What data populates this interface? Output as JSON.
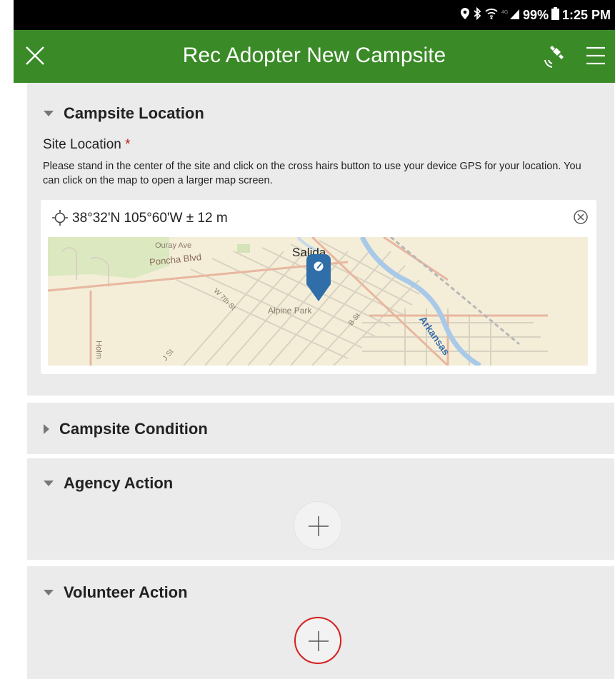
{
  "status_bar": {
    "battery": "99%",
    "time": "1:25 PM"
  },
  "app_bar": {
    "title": "Rec Adopter New Campsite"
  },
  "campsite_location": {
    "header": "Campsite Location",
    "site_label": "Site Location",
    "required_mark": "*",
    "help_text": "Please stand in the center of the site and click on the cross hairs button to use your device GPS for your location. You can click on the map to open a larger map screen.",
    "coordinates": "38°32'N 105°60'W ± 12 m",
    "map_labels": {
      "city": "Salida",
      "park": "Alpine Park",
      "street_1": "Ouray Ave",
      "street_2": "Poncha Blvd",
      "street_3": "W 7th St",
      "street_4": "B St",
      "street_5": "Holm",
      "street_6": "J St",
      "river": "Arkansas"
    }
  },
  "campsite_condition": {
    "header": "Campsite Condition"
  },
  "agency_action": {
    "header": "Agency Action"
  },
  "volunteer_action": {
    "header": "Volunteer Action"
  },
  "colors": {
    "app_bar": "#3a8a27",
    "panel": "#ebebeb",
    "required": "#c01818",
    "highlight": "#d62020",
    "pin": "#2f6ea8"
  }
}
